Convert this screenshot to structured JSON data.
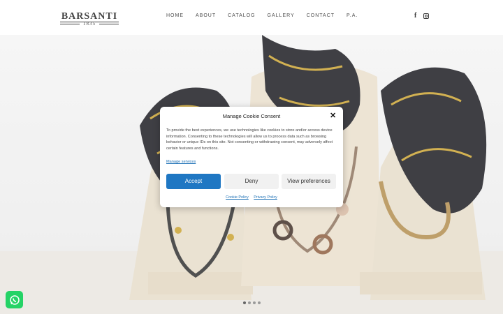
{
  "header": {
    "logo": {
      "name": "BARSANTI",
      "year": "1835"
    },
    "nav": [
      "HOME",
      "ABOUT",
      "CATALOG",
      "GALLERY",
      "CONTACT",
      "P.A."
    ],
    "social": [
      "facebook-icon",
      "instagram-icon"
    ]
  },
  "cookie": {
    "title": "Manage Cookie Consent",
    "body": "To provide the best experiences, we use technologies like cookies to store and/or access device information. Consenting to these technologies will allow us to process data such as browsing behavior or unique IDs on this site. Not consenting or withdrawing consent, may adversely affect certain features and functions.",
    "manage_link": "Manage services",
    "accept": "Accept",
    "deny": "Deny",
    "view_preferences": "View preferences",
    "cookie_policy": "Cookie Policy",
    "privacy_policy": "Privacy Policy"
  },
  "slider": {
    "dot_count": 4,
    "active_index": 0
  },
  "colors": {
    "accent": "#1f77c3",
    "whatsapp": "#25d366"
  }
}
